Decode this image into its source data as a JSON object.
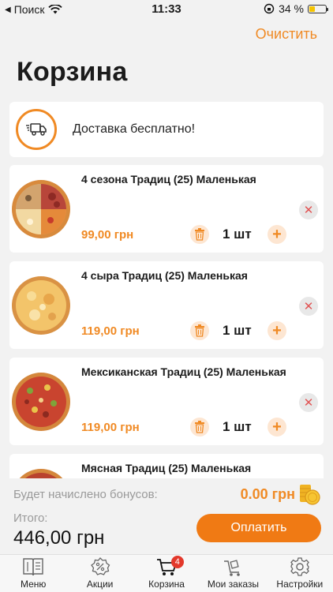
{
  "status_bar": {
    "carrier": "Поиск",
    "time": "11:33",
    "battery": "34 %",
    "battery_level": 0.34
  },
  "header": {
    "clear_label": "Очистить",
    "title": "Корзина"
  },
  "delivery": {
    "text": "Доставка бесплатно!"
  },
  "cart_items": [
    {
      "name": "4 сезона Традиц (25) Маленькая",
      "price": "99,00 грн",
      "qty": "1 шт"
    },
    {
      "name": "4 сыра Традиц (25) Маленькая",
      "price": "119,00 грн",
      "qty": "1 шт"
    },
    {
      "name": "Мексиканская Традиц (25) Маленькая",
      "price": "119,00 грн",
      "qty": "1 шт"
    },
    {
      "name": "Мясная Традиц (25) Маленькая",
      "price": "",
      "qty": ""
    }
  ],
  "summary": {
    "bonus_label": "Будет начислено бонусов:",
    "bonus_value": "0.00 грн",
    "total_label": "Итого:",
    "total_value": "446,00 грн",
    "pay_label": "Оплатить"
  },
  "tabs": [
    {
      "label": "Меню",
      "icon": "menu-book-icon"
    },
    {
      "label": "Акции",
      "icon": "discount-icon"
    },
    {
      "label": "Корзина",
      "icon": "cart-icon",
      "badge": "4"
    },
    {
      "label": "Мои заказы",
      "icon": "orders-cart-icon"
    },
    {
      "label": "Настройки",
      "icon": "gear-icon"
    }
  ],
  "colors": {
    "accent": "#f08a24",
    "pay_button": "#f07a14",
    "badge": "#e3382b",
    "background": "#f2f2f2"
  }
}
